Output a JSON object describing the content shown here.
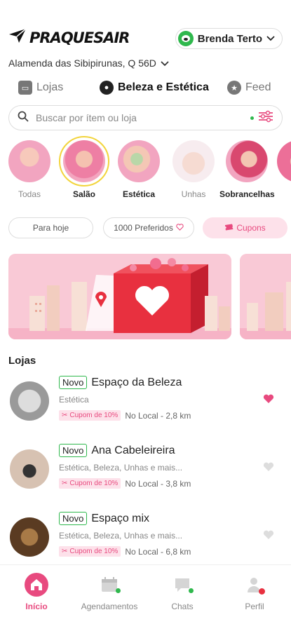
{
  "header": {
    "brand": "PRAQUESAIR",
    "user_name": "Brenda Terto",
    "address": "Alamenda das Sibipirunas, Q 56D"
  },
  "tabs": [
    {
      "label": "Lojas",
      "icon": "store-icon"
    },
    {
      "label": "Beleza e Estética",
      "icon": "beauty-icon"
    },
    {
      "label": "Feed",
      "icon": "star-icon"
    }
  ],
  "search": {
    "placeholder": "Buscar por ítem ou loja"
  },
  "stories": [
    {
      "label": "Todas"
    },
    {
      "label": "Salão"
    },
    {
      "label": "Estética"
    },
    {
      "label": "Unhas"
    },
    {
      "label": "Sobrancelhas"
    }
  ],
  "chips": [
    {
      "label": "Para hoje"
    },
    {
      "label": "1000 Preferidos"
    },
    {
      "label": "Cupons"
    }
  ],
  "section": {
    "title": "Lojas"
  },
  "stores": [
    {
      "badge": "Novo",
      "name": "Espaço da Beleza",
      "categories": "Estética",
      "coupon": "Cupom de 10%",
      "distance": "No Local - 2,8 km",
      "favorite": true
    },
    {
      "badge": "Novo",
      "name": "Ana Cabeleireira",
      "categories": "Estética, Beleza, Unhas e mais...",
      "coupon": "Cupom de 10%",
      "distance": "No Local - 3,8 km",
      "favorite": false
    },
    {
      "badge": "Novo",
      "name": "Espaço mix",
      "categories": "Estética, Beleza, Unhas e mais...",
      "coupon": "Cupom de 10%",
      "distance": "No Local - 6,8 km",
      "favorite": false
    }
  ],
  "bottom_nav": [
    {
      "label": "Início",
      "icon": "home-icon",
      "active": true
    },
    {
      "label": "Agendamentos",
      "icon": "calendar-icon",
      "active": false
    },
    {
      "label": "Chats",
      "icon": "chat-icon",
      "active": false
    },
    {
      "label": "Perfil",
      "icon": "profile-icon",
      "active": false
    }
  ],
  "colors": {
    "accent": "#e84a7f",
    "accent_light": "#fde1ea",
    "green": "#2fb84d",
    "highlight_ring": "#f2d43b"
  }
}
